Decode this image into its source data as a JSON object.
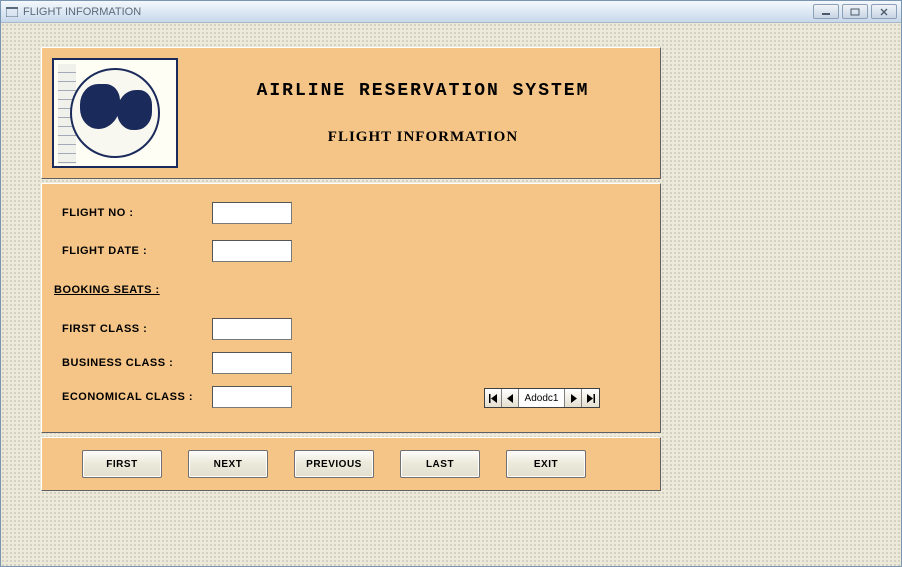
{
  "window": {
    "title": "FLIGHT INFORMATION"
  },
  "header": {
    "main_title": "AIRLINE RESERVATION SYSTEM",
    "sub_title": "FLIGHT INFORMATION"
  },
  "form": {
    "flight_no_label": "FLIGHT NO :",
    "flight_no_value": "",
    "flight_date_label": "FLIGHT DATE :",
    "flight_date_value": "",
    "booking_section": "BOOKING SEATS :",
    "first_class_label": "FIRST CLASS :",
    "first_class_value": "",
    "business_class_label": "BUSINESS CLASS :",
    "business_class_value": "",
    "economical_class_label": "ECONOMICAL CLASS :",
    "economical_class_value": ""
  },
  "adodc": {
    "caption": "Adodc1"
  },
  "buttons": {
    "first": "FIRST",
    "next": "NEXT",
    "previous": "PREVIOUS",
    "last": "LAST",
    "exit": "EXIT"
  }
}
